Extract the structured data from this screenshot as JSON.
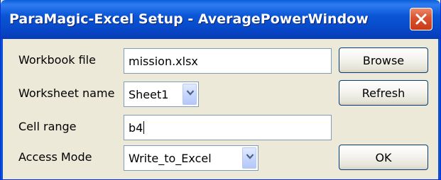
{
  "window": {
    "title": "ParaMagic-Excel Setup - AveragePowerWindow"
  },
  "form": {
    "workbook": {
      "label": "Workbook file",
      "value": "mission.xlsx"
    },
    "worksheet": {
      "label": "Worksheet name",
      "value": "Sheet1"
    },
    "cell_range": {
      "label": "Cell range",
      "value": "b4"
    },
    "access_mode": {
      "label": "Access Mode",
      "value": "Write_to_Excel"
    }
  },
  "buttons": {
    "browse": "Browse",
    "refresh": "Refresh",
    "ok": "OK"
  },
  "icons": {
    "close": "close-icon",
    "dropdown": "chevron-down-icon"
  },
  "colors": {
    "titlebar": "#0a56d6",
    "close_button": "#d9512d",
    "dialog_background": "#ece9d8"
  }
}
